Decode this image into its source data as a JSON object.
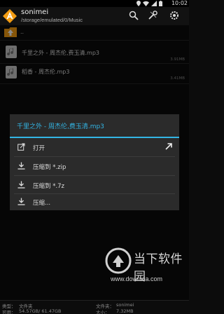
{
  "status_bar": {
    "time": "10:02",
    "icons": [
      "location-icon",
      "wifi-icon",
      "signal-icon",
      "battery-icon"
    ]
  },
  "app_bar": {
    "title": "sonimei",
    "path": "/storage/emulated/0/Music",
    "icons": [
      "search-icon",
      "tools-icon",
      "settings-icon"
    ]
  },
  "file_list": {
    "parent_label": "..",
    "items": [
      {
        "name": "千里之外 - 周杰伦,费玉清.mp3",
        "size": "3.91MB"
      },
      {
        "name": "稻香 - 周杰伦.mp3",
        "size": "3.41MB"
      }
    ]
  },
  "dialog": {
    "title": "千里之外 - 周杰伦,费玉清.mp3",
    "items": [
      {
        "label": "打开",
        "icon": "open-external-icon"
      },
      {
        "label": "压缩到 *.zip",
        "icon": "download-icon"
      },
      {
        "label": "压缩到 *.7z",
        "icon": "download-icon"
      },
      {
        "label": "压缩...",
        "icon": "download-icon"
      }
    ]
  },
  "watermark": {
    "title": "当下软件园",
    "url": "www.downxia.com"
  },
  "bottom_info": {
    "type_label": "类型：",
    "type_value": "文件夹",
    "available_label": "可用：",
    "available_value": "54.57GB/ 61.47GB",
    "folder_label": "文件夹：",
    "folder_value": "sonimei",
    "size_label": "大小：",
    "size_value": "7.32MB"
  },
  "colors": {
    "accent": "#33b5e5",
    "app_logo": "#f39c12",
    "background": "#0c0c0c",
    "dialog": "#2b2b2b"
  }
}
